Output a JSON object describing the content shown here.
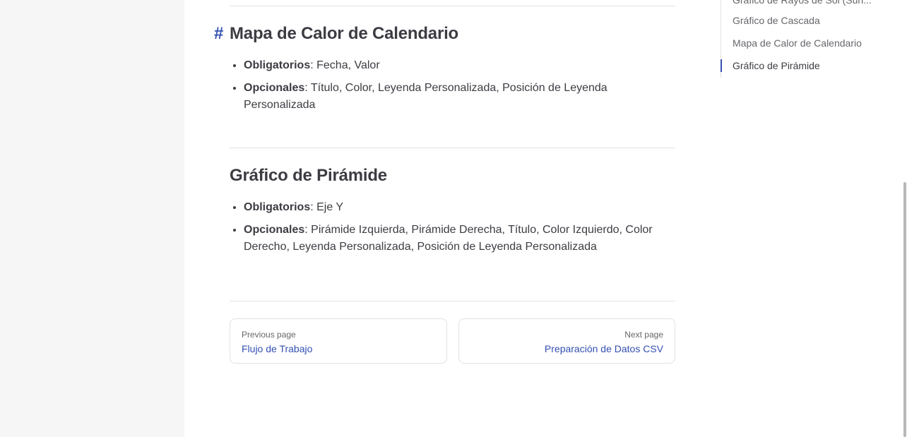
{
  "sections": [
    {
      "anchor": "#",
      "title": "Mapa de Calor de Calendario",
      "items": [
        {
          "label": "Obligatorios",
          "sep": ": ",
          "value": "Fecha, Valor"
        },
        {
          "label": "Opcionales",
          "sep": ": ",
          "value": "Título, Color, Leyenda Personalizada, Posición de Leyenda Personalizada"
        }
      ]
    },
    {
      "title": "Gráfico de Pirámide",
      "items": [
        {
          "label": "Obligatorios",
          "sep": ": ",
          "value": "Eje Y"
        },
        {
          "label": "Opcionales",
          "sep": ": ",
          "value": "Pirámide Izquierda, Pirámide Derecha, Título, Color Izquierdo, Color Derecho, Leyenda Personalizada, Posición de Leyenda Personalizada"
        }
      ]
    }
  ],
  "pager": {
    "prev": {
      "desc": "Previous page",
      "title": "Flujo de Trabajo"
    },
    "next": {
      "desc": "Next page",
      "title": "Preparación de Datos CSV"
    }
  },
  "outline": {
    "items": [
      {
        "label": "Gráfico de Rayos de Sol (Sun..."
      },
      {
        "label": "Gráfico de Cascada"
      },
      {
        "label": "Mapa de Calor de Calendario"
      },
      {
        "label": "Gráfico de Pirámide"
      }
    ]
  },
  "colors": {
    "brand": "#3451b2",
    "text": "#3c3c43",
    "muted": "#67676c",
    "divider": "#e2e2e3",
    "sidebar_bg": "#f6f6f7"
  }
}
